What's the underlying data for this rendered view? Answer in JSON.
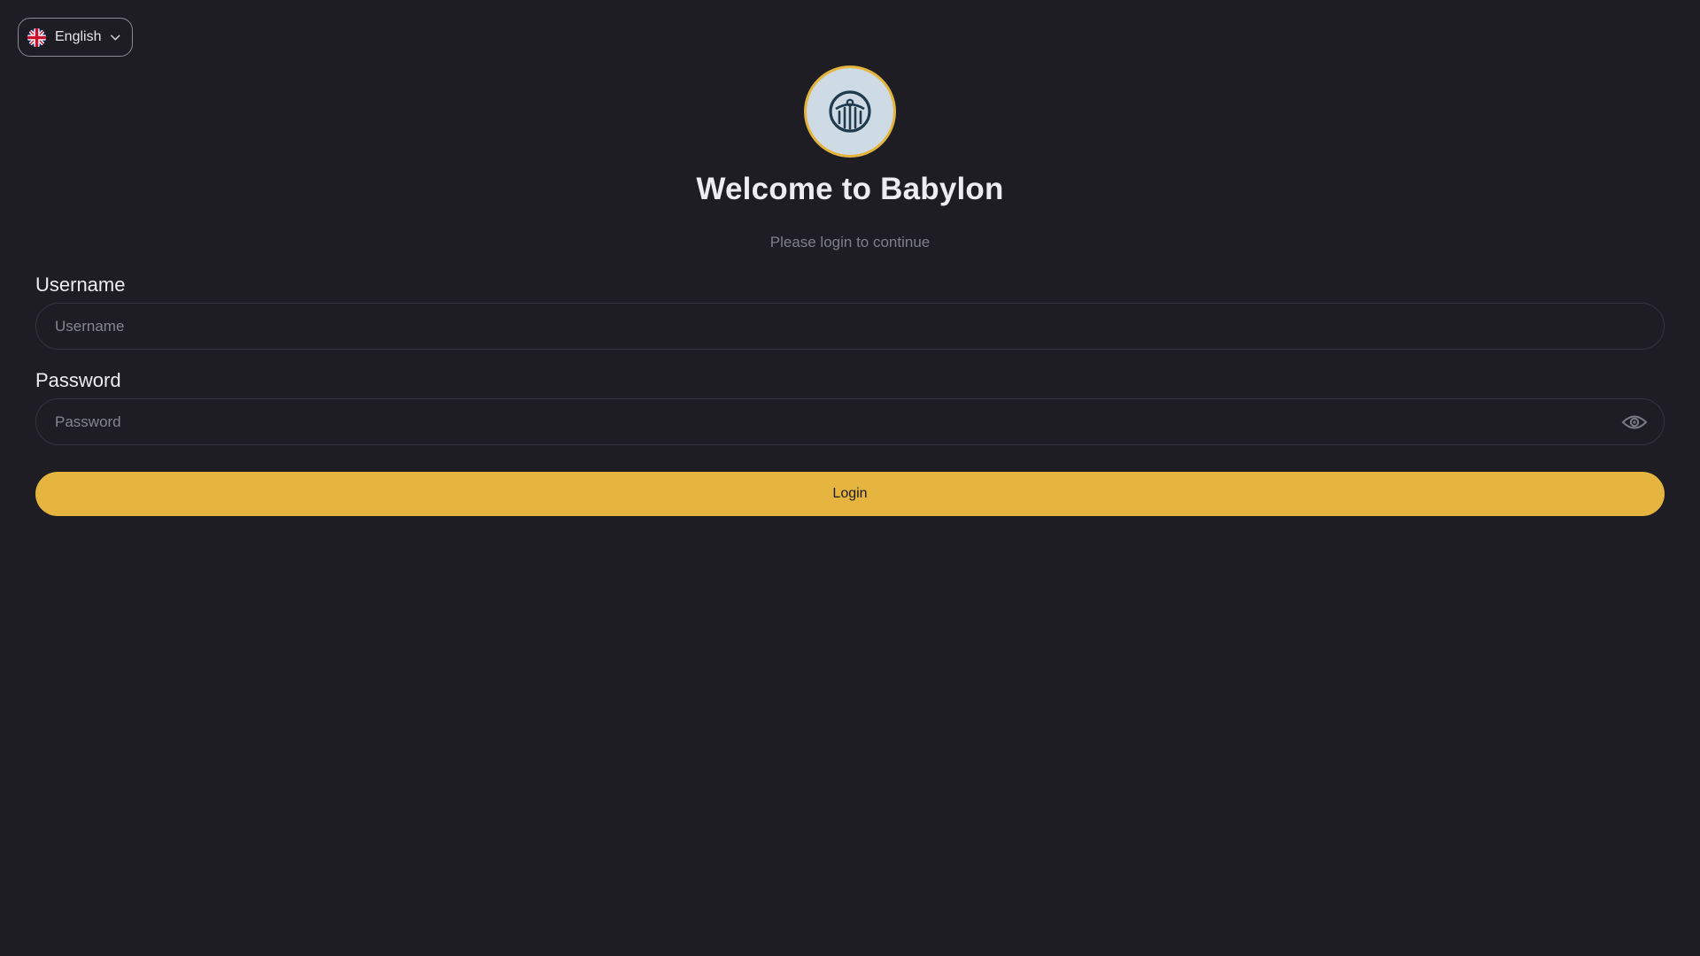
{
  "language_selector": {
    "flag_icon": "uk-flag-icon",
    "label": "English",
    "chevron_icon": "chevron-down-icon"
  },
  "header": {
    "logo_icon": "babylon-logo-icon",
    "title": "Welcome to Babylon",
    "subtitle": "Please login to continue"
  },
  "form": {
    "username": {
      "label": "Username",
      "value": "",
      "placeholder": "Username"
    },
    "password": {
      "label": "Password",
      "value": "",
      "placeholder": "Password",
      "toggle_icon": "eye-icon"
    },
    "login_label": "Login"
  },
  "colors": {
    "background": "#1d1d23",
    "accent": "#e5b540",
    "logo_bg": "#cfdbe4",
    "logo_fg": "#1f3b4e",
    "input_border": "#34343d",
    "muted_text": "#7f7f88"
  }
}
